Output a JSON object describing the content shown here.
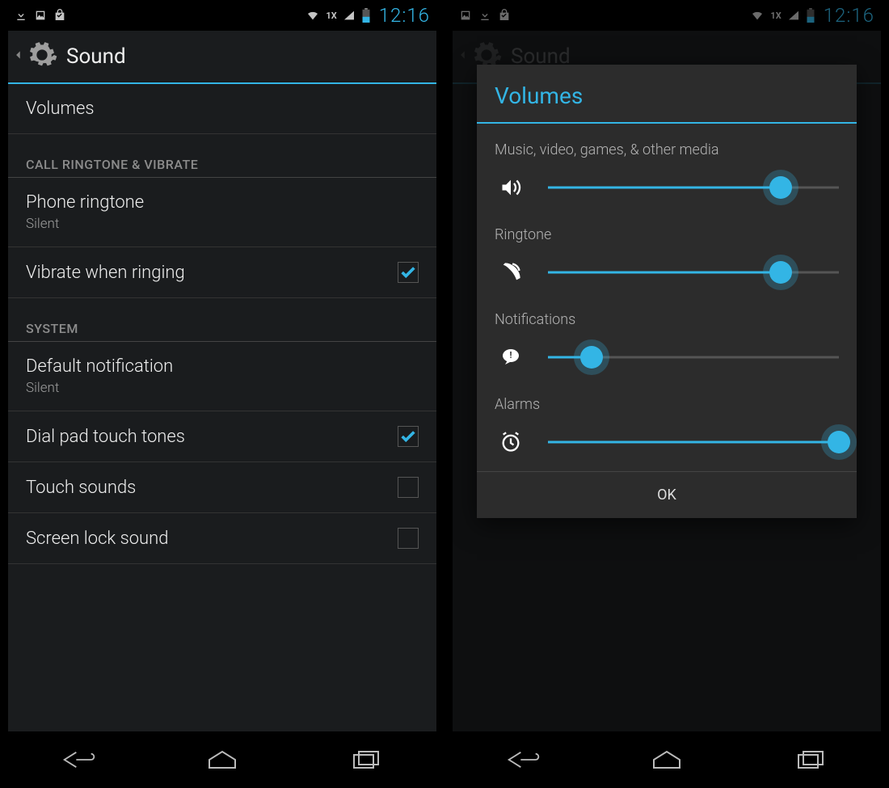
{
  "colors": {
    "accent": "#33b5e5",
    "bg": "#1a1c1e",
    "dialog": "#2c2c2c"
  },
  "status": {
    "time": "12:16",
    "network_text": "1X"
  },
  "page": {
    "title": "Sound"
  },
  "settings": {
    "volumes_label": "Volumes",
    "section_ringtone": "CALL RINGTONE & VIBRATE",
    "phone_ringtone_label": "Phone ringtone",
    "phone_ringtone_value": "Silent",
    "vibrate_label": "Vibrate when ringing",
    "vibrate_checked": true,
    "section_system": "SYSTEM",
    "default_notification_label": "Default notification",
    "default_notification_value": "Silent",
    "dial_pad_label": "Dial pad touch tones",
    "dial_pad_checked": true,
    "touch_sounds_label": "Touch sounds",
    "touch_sounds_checked": false,
    "screen_lock_label": "Screen lock sound",
    "screen_lock_checked": false
  },
  "dialog": {
    "title": "Volumes",
    "ok": "OK",
    "sliders": {
      "media": {
        "label": "Music, video, games, & other media",
        "value": 80
      },
      "ringtone": {
        "label": "Ringtone",
        "value": 80
      },
      "notifications": {
        "label": "Notifications",
        "value": 15
      },
      "alarms": {
        "label": "Alarms",
        "value": 100
      }
    }
  }
}
